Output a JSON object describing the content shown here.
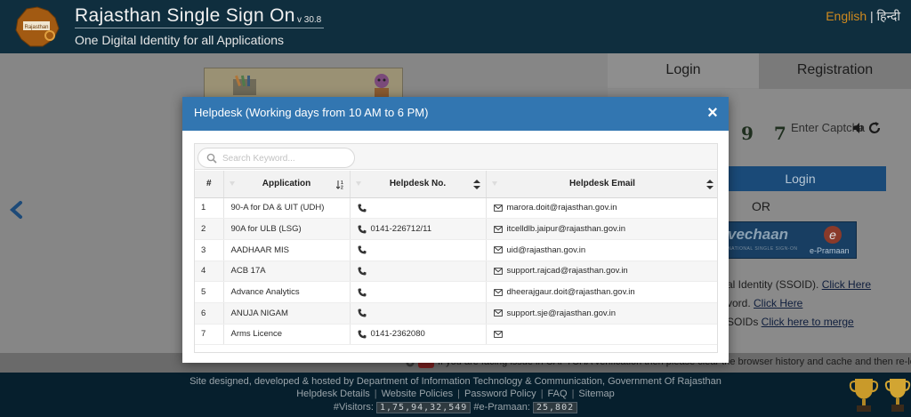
{
  "header": {
    "title": "Rajasthan Single Sign On",
    "version": "v 30.8",
    "subtitle": "One Digital Identity for all Applications",
    "lang_en": "English",
    "lang_sep": "|",
    "lang_hi": "हिन्दी"
  },
  "login_panel": {
    "tab_login": "Login",
    "tab_registration": "Registration",
    "captcha_digits": "9 7",
    "captcha_placeholder": "Enter Captcha",
    "login_button": "Login",
    "or_text": "OR",
    "epramaan_word": "vechaan",
    "epramaan_tag": "NATIONAL SINGLE SIGN-ON",
    "epramaan_name": "e-Pramaan",
    "help_line1_text": "al Identity (SSOID). ",
    "help_line1_link": "Click Here",
    "help_line2_text": "vord. ",
    "help_line2_link": "Click Here",
    "help_line3_text": "SOIDs ",
    "help_line3_link": "Click here to merge"
  },
  "notice": {
    "text": "If you are facing issue in CAPTCHA verification then please clear the browser history and cache and then re-login. A"
  },
  "footer": {
    "line1": "Site designed, developed & hosted by Department of Information Technology & Communication, Government Of Rajasthan",
    "links": [
      "Helpdesk Details",
      "Website Policies",
      "Password Policy",
      "FAQ",
      "Sitemap"
    ],
    "visitors_label": "#Visitors:",
    "visitors_count": "1,75,94,32,549",
    "epramaan_label": "#e-Pramaan:",
    "epramaan_count": "25,802"
  },
  "modal": {
    "title": "Helpdesk (Working days from 10 AM to 6 PM)",
    "close_label": "×",
    "search_placeholder": "Search Keyword...",
    "columns": [
      "#",
      "Application",
      "Helpdesk No.",
      "Helpdesk Email"
    ],
    "rows": [
      {
        "num": "1",
        "app": "90-A for DA & UIT (UDH)",
        "phone": "",
        "email": "marora.doit@rajasthan.gov.in"
      },
      {
        "num": "2",
        "app": "90A for ULB (LSG)",
        "phone": "0141-226712/11",
        "email": "itcelldlb.jaipur@rajasthan.gov.in"
      },
      {
        "num": "3",
        "app": "AADHAAR MIS",
        "phone": "",
        "email": "uid@rajasthan.gov.in"
      },
      {
        "num": "4",
        "app": "ACB 17A",
        "phone": "",
        "email": "support.rajcad@rajasthan.gov.in"
      },
      {
        "num": "5",
        "app": "Advance Analytics",
        "phone": "",
        "email": "dheerajgaur.doit@rajasthan.gov.in"
      },
      {
        "num": "6",
        "app": "ANUJA NIGAM",
        "phone": "",
        "email": "support.sje@rajasthan.gov.in"
      },
      {
        "num": "7",
        "app": "Arms Licence",
        "phone": "0141-2362080",
        "email": ""
      }
    ]
  },
  "colors": {
    "header_bg": "#0f2e3e",
    "modal_header": "#3276b1",
    "footer_bg": "#061f2d",
    "lang_accent": "#d08a1e"
  }
}
